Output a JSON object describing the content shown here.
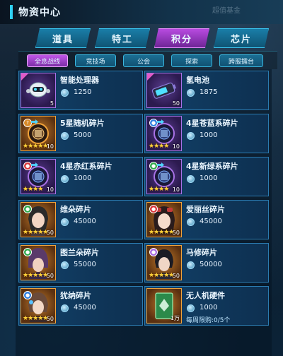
{
  "header": {
    "title": "物资中心",
    "watermark": "超值基金"
  },
  "main_tabs": [
    {
      "label": "道具",
      "active": false
    },
    {
      "label": "特工",
      "active": false
    },
    {
      "label": "积分",
      "active": true
    },
    {
      "label": "芯片",
      "active": false
    }
  ],
  "sub_tabs": [
    {
      "label": "全息战线",
      "active": true
    },
    {
      "label": "竞技场",
      "active": false
    },
    {
      "label": "公会",
      "active": false
    },
    {
      "label": "探索",
      "active": false
    },
    {
      "label": "跨服擂台",
      "active": false
    }
  ],
  "items": [
    {
      "name": "智能处理器",
      "price": "1250",
      "count": "5",
      "stars": "",
      "frame": "purple",
      "icon": "robot-drone-icon"
    },
    {
      "name": "氢电池",
      "price": "1875",
      "count": "50",
      "stars": "",
      "frame": "purple",
      "icon": "battery-icon"
    },
    {
      "name": "5星随机碎片",
      "price": "5000",
      "count": "10",
      "stars": "★★★★★",
      "frame": "orange",
      "icon": "random-shard-icon"
    },
    {
      "name": "4星苍蓝系碎片",
      "price": "1000",
      "count": "10",
      "stars": "★★★★",
      "frame": "purple",
      "icon": "blue-shard-icon"
    },
    {
      "name": "4星赤红系碎片",
      "price": "1000",
      "count": "10",
      "stars": "★★★★",
      "frame": "purple",
      "icon": "red-shard-icon"
    },
    {
      "name": "4星新绿系碎片",
      "price": "1000",
      "count": "10",
      "stars": "★★★★",
      "frame": "purple",
      "icon": "green-shard-icon"
    },
    {
      "name": "维朵碎片",
      "price": "45000",
      "count": "50",
      "stars": "★★★★★",
      "frame": "orange",
      "icon": "character-portrait-icon"
    },
    {
      "name": "爱丽丝碎片",
      "price": "45000",
      "count": "50",
      "stars": "★★★★★",
      "frame": "orange",
      "icon": "character-portrait-icon"
    },
    {
      "name": "图兰朵碎片",
      "price": "55000",
      "count": "50",
      "stars": "★★★★★",
      "frame": "orange",
      "icon": "character-portrait-icon"
    },
    {
      "name": "马修碎片",
      "price": "50000",
      "count": "50",
      "stars": "★★★★★",
      "frame": "orange",
      "icon": "character-portrait-icon"
    },
    {
      "name": "犹纳碎片",
      "price": "45000",
      "count": "50",
      "stars": "★★★★★",
      "frame": "orange",
      "icon": "character-portrait-icon"
    },
    {
      "name": "无人机硬件",
      "price": "1000",
      "count": "1万",
      "stars": "",
      "frame": "orange",
      "icon": "drone-hardware-icon",
      "limit": "每周限购:0/5个"
    }
  ]
}
